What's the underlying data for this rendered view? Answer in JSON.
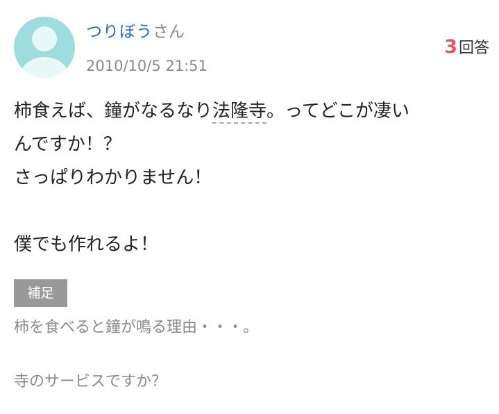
{
  "user": {
    "name": "つりぼう",
    "honorific": "さん",
    "timestamp": "2010/10/5 21:51",
    "avatar_icon": "user-avatar-icon",
    "avatar_color": "#9fdcdf"
  },
  "answers": {
    "count": "3",
    "label": "回答",
    "count_color": "#e0566a"
  },
  "question": {
    "line1_before": "柿食えば、鐘がなるなり",
    "line1_keyword": "法隆寺",
    "line1_after": "。ってどこが凄い",
    "line2": "んですか！？",
    "line3": "さっぱりわかりません！",
    "line4": "",
    "line5": "僕でも作れるよ！"
  },
  "supplement": {
    "badge": "補足",
    "line1": "柿を食べると鐘が鳴る理由・・・。",
    "line2": "寺のサービスですか？"
  }
}
